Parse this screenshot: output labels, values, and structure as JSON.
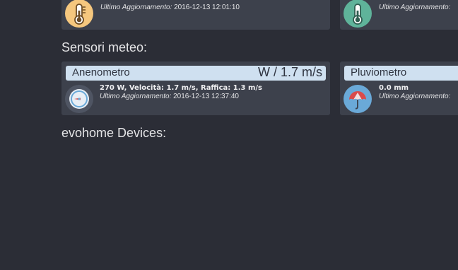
{
  "top_cards": [
    {
      "updated_label": "Ultimo Aggiornamento:",
      "updated_value": "2016-12-13 12:01:10",
      "icon": "thermometer-icon",
      "icon_color": "#f5c77e"
    },
    {
      "updated_label": "Ultimo Aggiornamento:",
      "updated_value": "",
      "icon": "thermometer-icon",
      "icon_color": "#5fb39a"
    }
  ],
  "weather_section": {
    "title": "Sensori meteo:",
    "cards": [
      {
        "name": "Anenometro",
        "value": "W / 1.7 m/s",
        "status": "270 W, Velocità: 1.7 m/s, Raffica: 1.3 m/s",
        "updated_label": "Ultimo Aggiornamento:",
        "updated_value": "2016-12-13 12:37:40",
        "icon": "wind-compass-icon"
      },
      {
        "name": "Pluviometro",
        "value": "",
        "status": "0.0 mm",
        "updated_label": "Ultimo Aggiornamento:",
        "updated_value": "",
        "icon": "umbrella-icon"
      }
    ]
  },
  "evohome_section": {
    "title": "evohome Devices:"
  }
}
